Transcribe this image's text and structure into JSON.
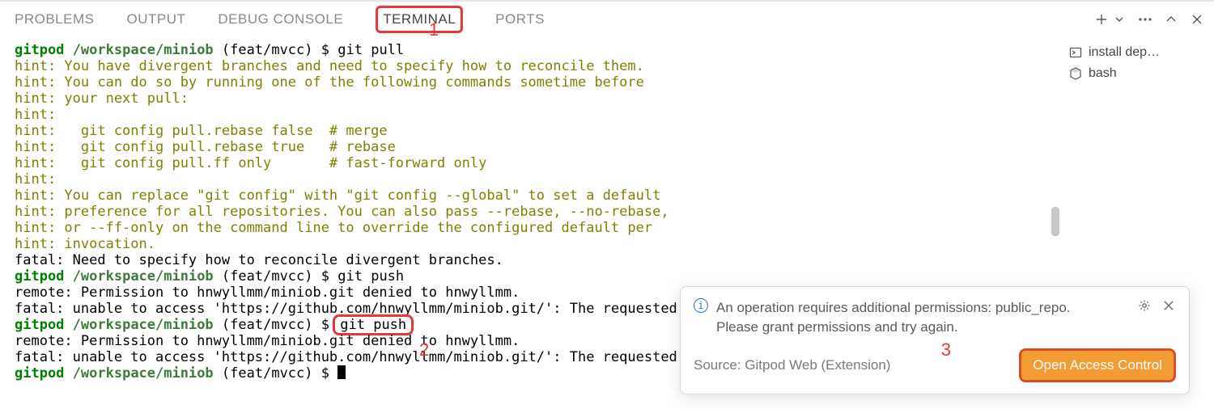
{
  "tabs": {
    "problems": "PROBLEMS",
    "output": "OUTPUT",
    "debug": "DEBUG CONSOLE",
    "terminal": "TERMINAL",
    "ports": "PORTS"
  },
  "annotations": {
    "one": "1",
    "two": "2",
    "three": "3"
  },
  "sidebar_terminals": [
    {
      "icon": "cmd",
      "label": "install dep…"
    },
    {
      "icon": "bash",
      "label": "bash"
    }
  ],
  "prompt": {
    "host": "gitpod",
    "path": "/workspace/miniob",
    "branch": "(feat/mvcc)",
    "sym": "$"
  },
  "cmds": {
    "pull": "git pull",
    "push": "git push"
  },
  "hints": [
    "hint: You have divergent branches and need to specify how to reconcile them.",
    "hint: You can do so by running one of the following commands sometime before",
    "hint: your next pull:",
    "hint:",
    "hint:   git config pull.rebase false  # merge",
    "hint:   git config pull.rebase true   # rebase",
    "hint:   git config pull.ff only       # fast-forward only",
    "hint:",
    "hint: You can replace \"git config\" with \"git config --global\" to set a default",
    "hint: preference for all repositories. You can also pass --rebase, --no-rebase,",
    "hint: or --ff-only on the command line to override the configured default per",
    "hint: invocation."
  ],
  "fatal_divergent": "fatal: Need to specify how to reconcile divergent branches.",
  "push_out": {
    "denied": "remote: Permission to hnwyllmm/miniob.git denied to hnwyllmm.",
    "unable": "fatal: unable to access 'https://github.com/hnwyllmm/miniob.git/': The requested"
  },
  "notification": {
    "line1": "An operation requires additional permissions: public_repo.",
    "line2": "Please grant permissions and try again.",
    "source": "Source: Gitpod Web (Extension)",
    "button": "Open Access Control"
  }
}
